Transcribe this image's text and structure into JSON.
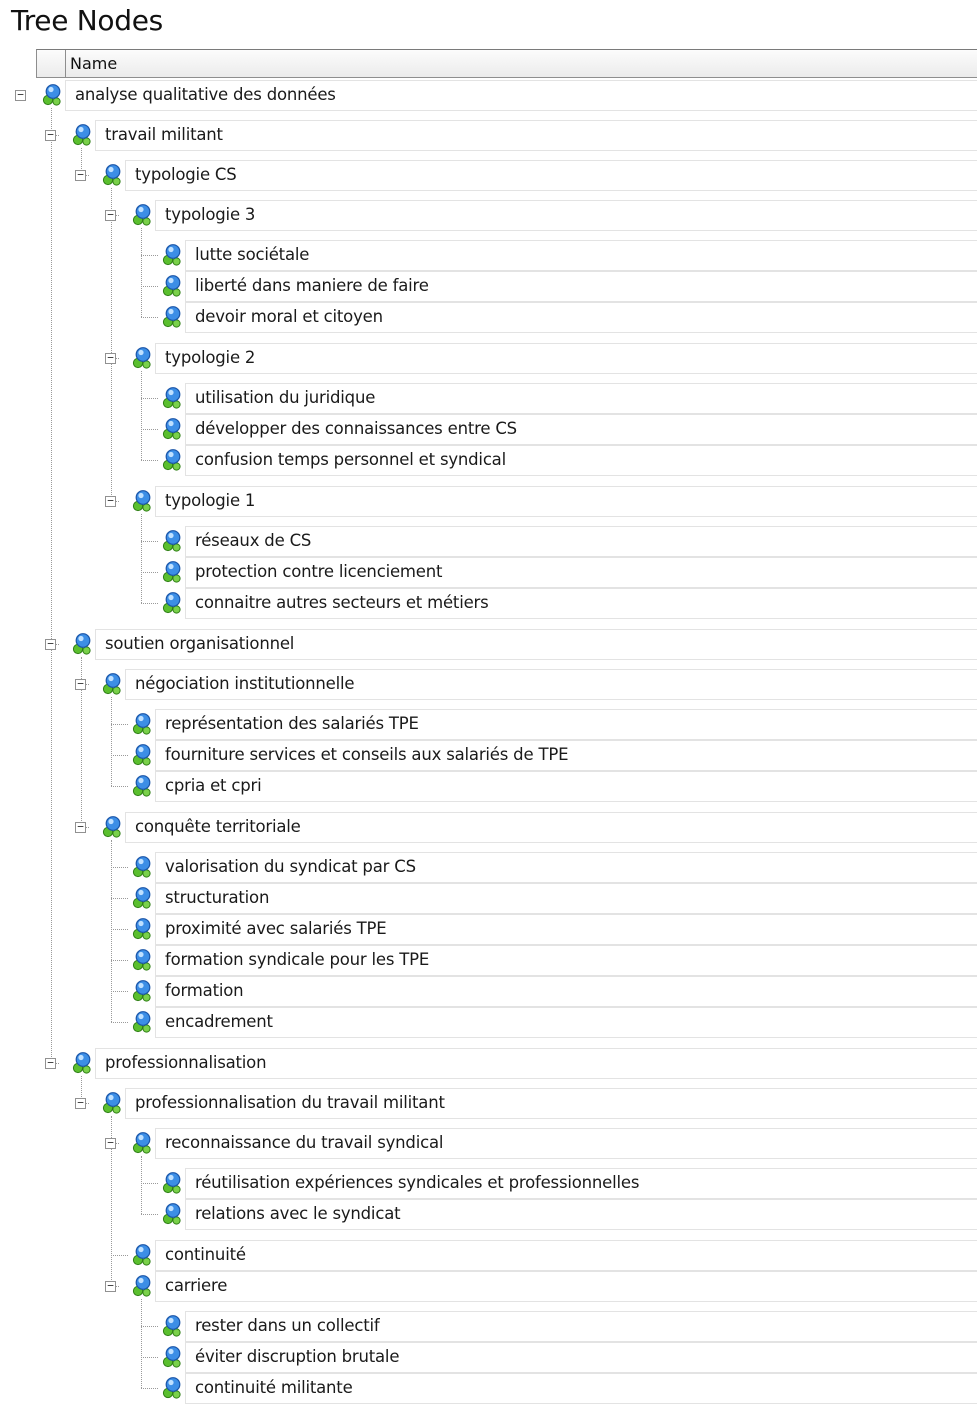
{
  "page": {
    "title": "Tree Nodes"
  },
  "table": {
    "column_name": "Name"
  },
  "icons": {
    "node": "tree-node-icon"
  },
  "nodes": [
    {
      "label": "analyse qualitative des données",
      "level": 0,
      "expanded": true
    },
    {
      "label": "travail militant",
      "level": 1,
      "expanded": true
    },
    {
      "label": "typologie CS",
      "level": 2,
      "expanded": true
    },
    {
      "label": "typologie 3",
      "level": 3,
      "expanded": true
    },
    {
      "label": "lutte sociétale",
      "level": 4
    },
    {
      "label": "liberté dans maniere de faire",
      "level": 4
    },
    {
      "label": "devoir moral et citoyen",
      "level": 4
    },
    {
      "label": "typologie 2",
      "level": 3,
      "expanded": true
    },
    {
      "label": "utilisation du juridique",
      "level": 4
    },
    {
      "label": "développer des connaissances entre CS",
      "level": 4
    },
    {
      "label": "confusion temps personnel et syndical",
      "level": 4
    },
    {
      "label": "typologie 1",
      "level": 3,
      "expanded": true
    },
    {
      "label": "réseaux de CS",
      "level": 4
    },
    {
      "label": "protection contre licenciement",
      "level": 4
    },
    {
      "label": "connaitre autres secteurs et métiers",
      "level": 4
    },
    {
      "label": "soutien organisationnel",
      "level": 1,
      "expanded": true
    },
    {
      "label": "négociation institutionnelle",
      "level": 2,
      "expanded": true
    },
    {
      "label": "représentation des salariés TPE",
      "level": 3
    },
    {
      "label": "fourniture services et conseils aux salariés de TPE",
      "level": 3
    },
    {
      "label": "cpria et cpri",
      "level": 3
    },
    {
      "label": "conquête territoriale",
      "level": 2,
      "expanded": true
    },
    {
      "label": "valorisation du syndicat par CS",
      "level": 3
    },
    {
      "label": "structuration",
      "level": 3
    },
    {
      "label": "proximité avec salariés TPE",
      "level": 3
    },
    {
      "label": "formation syndicale pour les TPE",
      "level": 3
    },
    {
      "label": "formation",
      "level": 3
    },
    {
      "label": "encadrement",
      "level": 3
    },
    {
      "label": "professionnalisation",
      "level": 1,
      "expanded": true
    },
    {
      "label": "professionnalisation du travail militant",
      "level": 2,
      "expanded": true
    },
    {
      "label": "reconnaissance du travail syndical",
      "level": 3,
      "expanded": true
    },
    {
      "label": "réutilisation expériences syndicales et professionnelles",
      "level": 4
    },
    {
      "label": "relations avec le syndicat",
      "level": 4
    },
    {
      "label": "continuité",
      "level": 3
    },
    {
      "label": "carriere",
      "level": 3,
      "expanded": true
    },
    {
      "label": "rester dans un collectif",
      "level": 4
    },
    {
      "label": "éviter discruption brutale",
      "level": 4
    },
    {
      "label": "continuité militante",
      "level": 4
    }
  ]
}
